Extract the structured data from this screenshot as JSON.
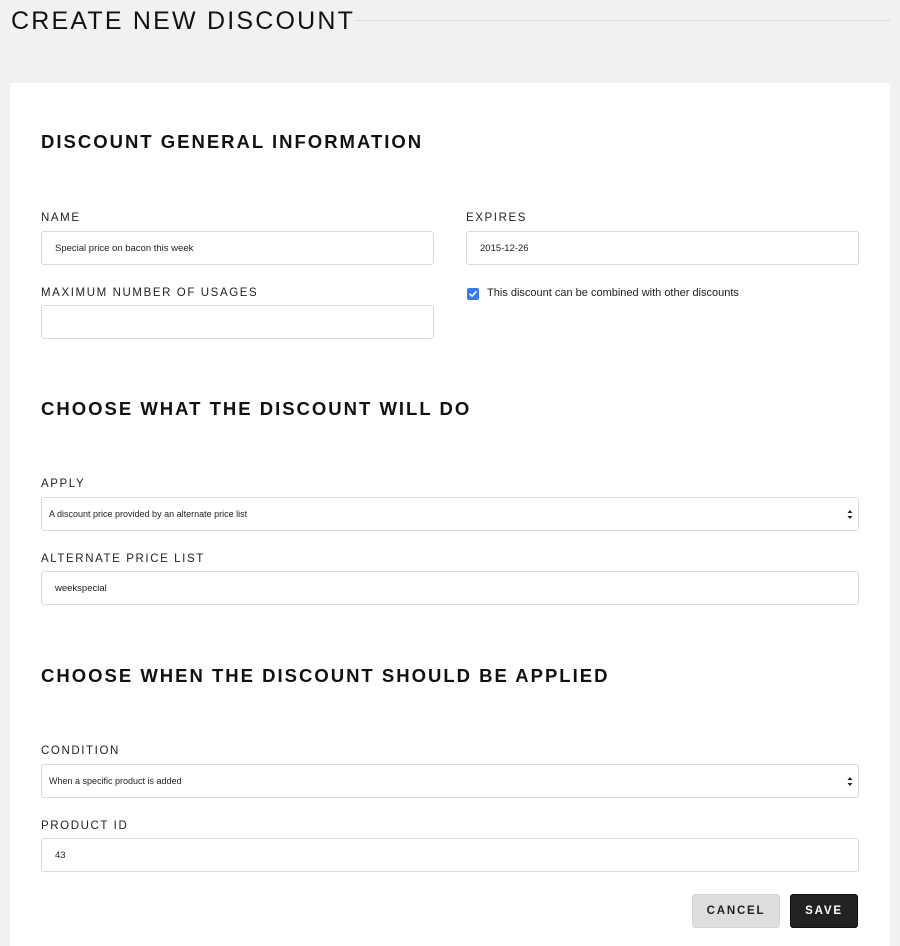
{
  "header": {
    "title": "CREATE NEW DISCOUNT"
  },
  "sections": {
    "general": {
      "heading": "DISCOUNT GENERAL INFORMATION",
      "name_label": "NAME",
      "name_value": "Special price on bacon this week",
      "expires_label": "EXPIRES",
      "expires_value": "2015-12-26",
      "max_usages_label": "MAXIMUM NUMBER OF USAGES",
      "max_usages_value": "",
      "combinable_label": "This discount can be combined with other discounts",
      "combinable_checked": true
    },
    "action": {
      "heading": "CHOOSE WHAT THE DISCOUNT WILL DO",
      "apply_label": "APPLY",
      "apply_selected": "A discount price provided by an alternate price list",
      "price_list_label": "ALTERNATE PRICE LIST",
      "price_list_value": "weekspecial"
    },
    "condition": {
      "heading": "CHOOSE WHEN THE DISCOUNT SHOULD BE APPLIED",
      "condition_label": "CONDITION",
      "condition_selected": "When a specific product is added",
      "product_id_label": "PRODUCT ID",
      "product_id_value": "43"
    }
  },
  "actions": {
    "cancel_label": "CANCEL",
    "save_label": "SAVE"
  },
  "colors": {
    "checkbox_accent": "#2f7cf6",
    "save_button": "#222222",
    "cancel_button": "#dedede"
  }
}
